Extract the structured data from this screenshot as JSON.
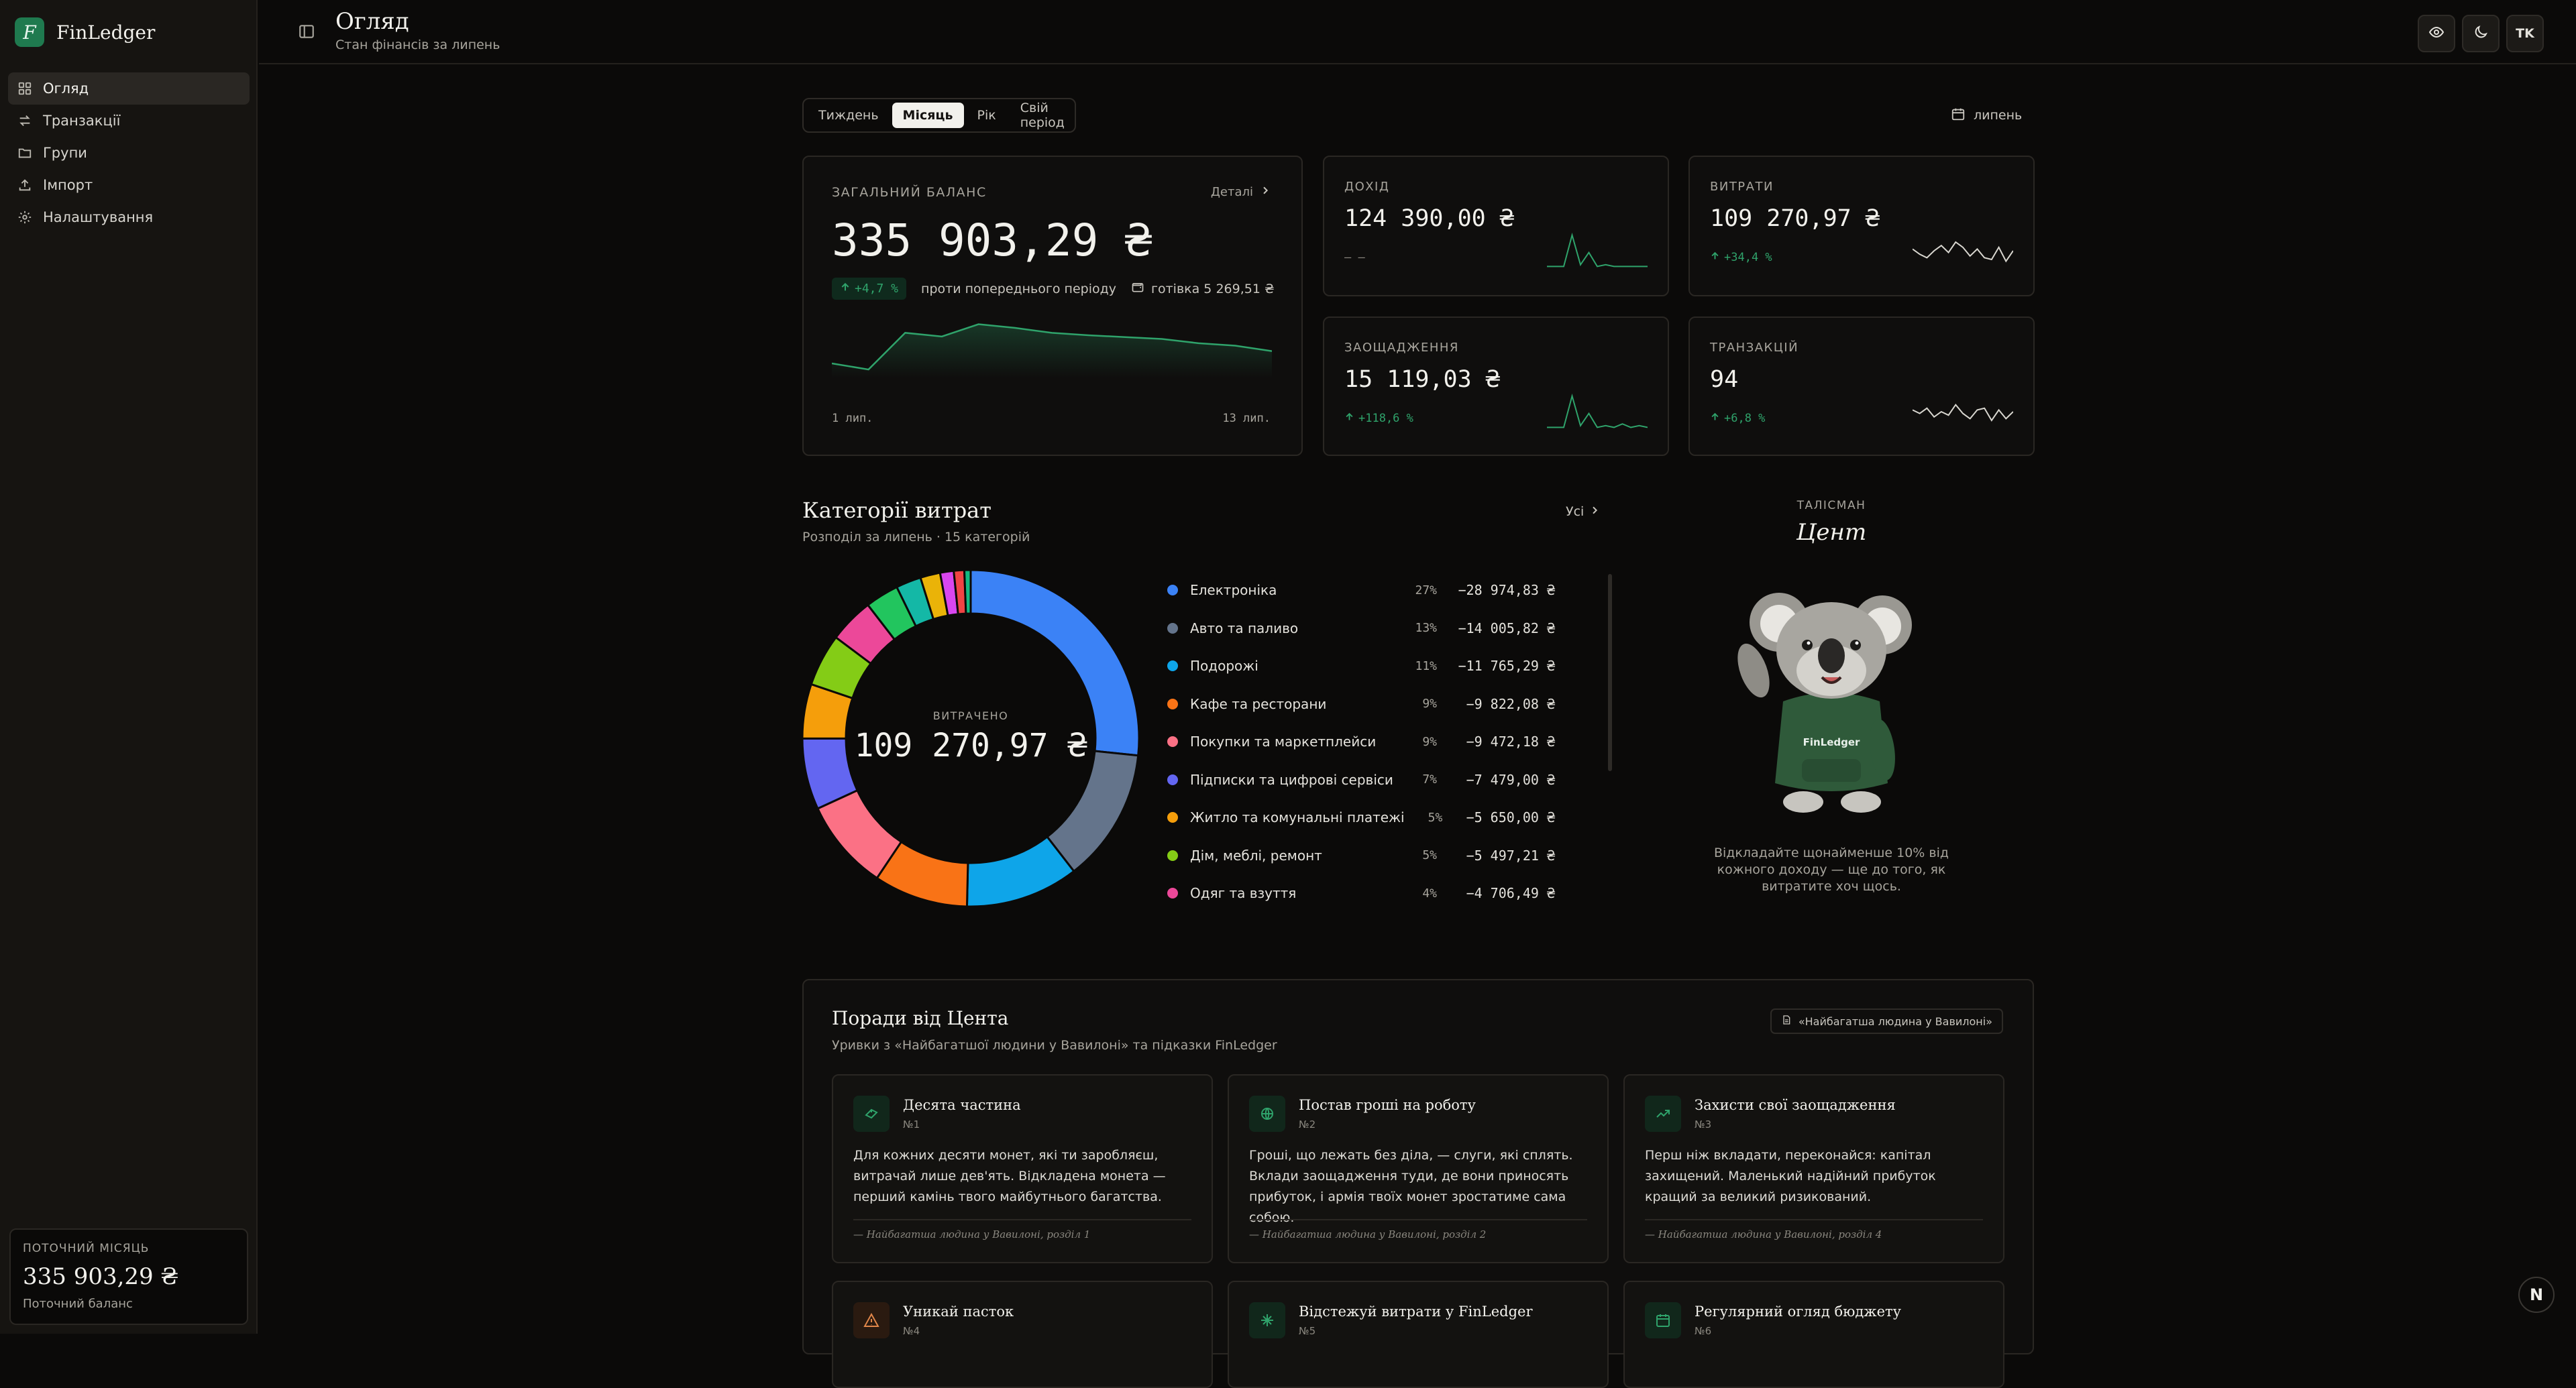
{
  "brand": {
    "logo_letter": "F",
    "name": "FinLedger"
  },
  "nav": {
    "items": [
      {
        "label": "Огляд",
        "icon": "grid-icon",
        "active": true
      },
      {
        "label": "Транзакції",
        "icon": "arrows-icon"
      },
      {
        "label": "Групи",
        "icon": "folder-icon"
      },
      {
        "label": "Імпорт",
        "icon": "upload-icon"
      },
      {
        "label": "Налаштування",
        "icon": "gear-icon"
      }
    ]
  },
  "sidebar_card": {
    "label": "ПОТОЧНИЙ МІСЯЦЬ",
    "value": "335 903,29 ₴",
    "sub": "Поточний баланс"
  },
  "header": {
    "title": "Огляд",
    "subtitle": "Стан фінансів за липень",
    "avatar": "TK"
  },
  "period": {
    "tabs": [
      "Тиждень",
      "Місяць",
      "Рік",
      "Свій період"
    ],
    "active": "Місяць",
    "month": "липень"
  },
  "balance": {
    "label": "ЗАГАЛЬНИЙ БАЛАНС",
    "details": "Деталі",
    "value": "335 903,29 ₴",
    "delta": "+4,7 %",
    "delta_text": "проти попереднього періоду",
    "cash": "готівка 5 269,51 ₴",
    "axis_start": "1 лип.",
    "axis_end": "13 лип.",
    "series": [
      0.22,
      0.12,
      0.72,
      0.66,
      0.86,
      0.8,
      0.72,
      0.68,
      0.65,
      0.62,
      0.55,
      0.51,
      0.42
    ]
  },
  "kpis": {
    "income": {
      "label": "ДОХІД",
      "value": "124 390,00 ₴",
      "delta": "— —",
      "trend": "neutral",
      "spark": [
        0.05,
        0.05,
        0.05,
        0.95,
        0.1,
        0.45,
        0.05,
        0.1,
        0.05,
        0.05,
        0.05,
        0.05,
        0.05
      ]
    },
    "expenses": {
      "label": "ВИТРАТИ",
      "value": "109 270,97 ₴",
      "delta": "+34,4 %",
      "trend": "up",
      "spark": [
        0.55,
        0.4,
        0.3,
        0.5,
        0.65,
        0.45,
        0.75,
        0.6,
        0.35,
        0.55,
        0.3,
        0.25,
        0.6,
        0.2,
        0.5
      ]
    },
    "savings": {
      "label": "ЗАОЩАДЖЕННЯ",
      "value": "15 119,03 ₴",
      "delta": "+118,6 %",
      "trend": "up",
      "spark": [
        0.05,
        0.05,
        0.05,
        0.95,
        0.1,
        0.45,
        0.05,
        0.1,
        0.05,
        0.15,
        0.05,
        0.1,
        0.05
      ]
    },
    "transactions": {
      "label": "ТРАНЗАКЦІЙ",
      "value": "94",
      "delta": "+6,8 %",
      "trend": "up",
      "spark": [
        0.55,
        0.45,
        0.6,
        0.35,
        0.5,
        0.4,
        0.7,
        0.45,
        0.3,
        0.55,
        0.6,
        0.25,
        0.55,
        0.3,
        0.5
      ]
    }
  },
  "categories": {
    "title": "Категорії витрат",
    "subtitle": "Розподіл за липень · 15 категорій",
    "all_link": "Усі",
    "center_label": "ВИТРАЧЕНО",
    "center_value": "109 270,97 ₴",
    "items": [
      {
        "name": "Електроніка",
        "pct": "27%",
        "amount": "−28 974,83 ₴",
        "share": 26.5,
        "color": "#3b82f6"
      },
      {
        "name": "Авто та паливо",
        "pct": "13%",
        "amount": "−14 005,82 ₴",
        "share": 12.8,
        "color": "#64748b"
      },
      {
        "name": "Подорожі",
        "pct": "11%",
        "amount": "−11 765,29 ₴",
        "share": 10.8,
        "color": "#0ea5e9"
      },
      {
        "name": "Кафе та ресторани",
        "pct": "9%",
        "amount": "−9 822,08 ₴",
        "share": 9.0,
        "color": "#f97316"
      },
      {
        "name": "Покупки та маркетплейси",
        "pct": "9%",
        "amount": "−9 472,18 ₴",
        "share": 8.7,
        "color": "#fb7185"
      },
      {
        "name": "Підписки та цифрові сервіси",
        "pct": "7%",
        "amount": "−7 479,00 ₴",
        "share": 6.8,
        "color": "#6366f1"
      },
      {
        "name": "Житло та комунальні платежі",
        "pct": "5%",
        "amount": "−5 650,00 ₴",
        "share": 5.2,
        "color": "#f59e0b"
      },
      {
        "name": "Дім, меблі, ремонт",
        "pct": "5%",
        "amount": "−5 497,21 ₴",
        "share": 5.0,
        "color": "#84cc16"
      },
      {
        "name": "Одяг та взуття",
        "pct": "4%",
        "amount": "−4 706,49 ₴",
        "share": 4.3,
        "color": "#ec4899"
      }
    ],
    "extra_segments": [
      {
        "share": 3.2,
        "color": "#22c55e"
      },
      {
        "share": 2.4,
        "color": "#14b8a6"
      },
      {
        "share": 1.9,
        "color": "#eab308"
      },
      {
        "share": 1.3,
        "color": "#d946ef"
      },
      {
        "share": 1.0,
        "color": "#ef4444"
      },
      {
        "share": 0.6,
        "color": "#10b981"
      }
    ]
  },
  "mascot": {
    "label": "ТАЛІСМАН",
    "name": "Цент",
    "hoodie_text": "FinLedger",
    "tip": "Відкладайте щонайменше 10% від кожного доходу — ще до того, як витратите хоч щось."
  },
  "tips": {
    "title": "Поради від Цента",
    "subtitle": "Уривки з «Найбагатшої людини у Вавилоні» та підказки FinLedger",
    "book_button": "«Найбагатша людина у Вавилоні»",
    "cards": [
      {
        "title": "Десята частина",
        "num": "№1",
        "icon": "coins-icon",
        "text": "Для кожних десяти монет, які ти заробляєш, витрачай лише дев'ять. Відкладена монета — перший камінь твого майбутнього багатства.",
        "source": "— Найбагатша людина у Вавилоні, розділ 1"
      },
      {
        "title": "Постав гроші на роботу",
        "num": "№2",
        "icon": "globe-icon",
        "text": "Гроші, що лежать без діла, — слуги, які сплять. Вклади заощадження туди, де вони приносять прибуток, і армія твоїх монет зростатиме сама собою.",
        "source": "— Найбагатша людина у Вавилоні, розділ 2"
      },
      {
        "title": "Захисти свої заощадження",
        "num": "№3",
        "icon": "trend-up-icon",
        "text": "Перш ніж вкладати, переконайся: капітал захищений. Маленький надійний прибуток кращий за великий ризикований.",
        "source": "— Найбагатша людина у Вавилоні, розділ 4"
      },
      {
        "title": "Уникай пасток",
        "num": "№4",
        "icon": "warning-icon"
      },
      {
        "title": "Відстежуй витрати у FinLedger",
        "num": "№5",
        "icon": "sparkle-icon"
      },
      {
        "title": "Регулярний огляд бюджету",
        "num": "№6",
        "icon": "calendar-icon"
      }
    ]
  },
  "framework_badge": "N"
}
